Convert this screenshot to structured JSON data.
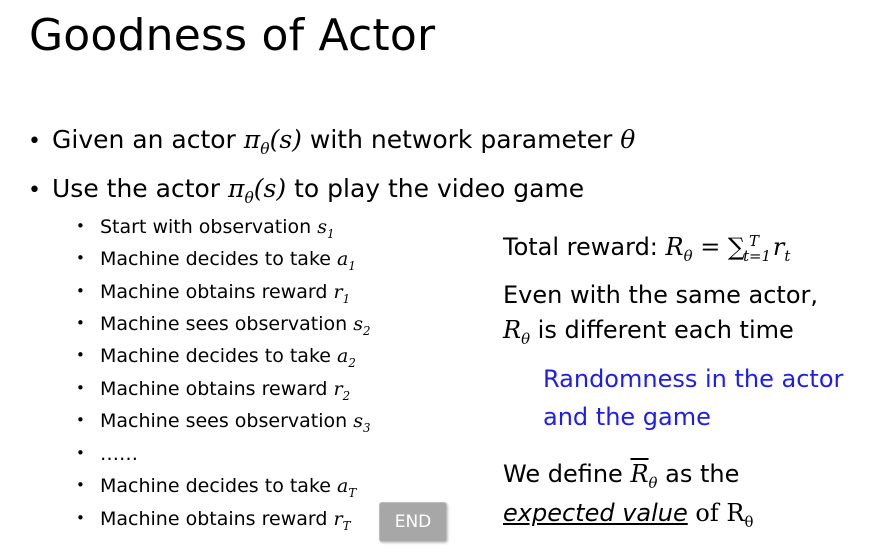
{
  "title": "Goodness of Actor",
  "bullets": [
    {
      "prefix": "Given an actor ",
      "pi": "π",
      "theta_sub": "θ",
      "arg": "(s)",
      "suffix": " with network parameter ",
      "theta": "θ"
    },
    {
      "prefix": "Use the actor ",
      "pi": "π",
      "theta_sub": "θ",
      "arg": "(s)",
      "suffix": " to play the video game"
    }
  ],
  "sub_bullets": [
    {
      "text": "Start with observation ",
      "var": "s",
      "sub": "1"
    },
    {
      "text": "Machine decides to take ",
      "var": "a",
      "sub": "1"
    },
    {
      "text": "Machine obtains reward ",
      "var": "r",
      "sub": "1"
    },
    {
      "text": "Machine sees observation ",
      "var": "s",
      "sub": "2"
    },
    {
      "text": "Machine decides to take ",
      "var": "a",
      "sub": "2"
    },
    {
      "text": "Machine obtains reward ",
      "var": "r",
      "sub": "2"
    },
    {
      "text": "Machine sees observation ",
      "var": "s",
      "sub": "3"
    },
    {
      "text": "……",
      "var": "",
      "sub": ""
    },
    {
      "text": "Machine decides to take ",
      "var": "a",
      "sub": "T"
    },
    {
      "text": "Machine obtains reward ",
      "var": "r",
      "sub": "T"
    }
  ],
  "end_button": "END",
  "right": {
    "total_reward_label": "Total reward: ",
    "R": "R",
    "theta": "θ",
    "equals_sum": " = ∑",
    "sum_sub": "t=1",
    "sum_sup": "T",
    "r": "r",
    "r_sub": "t",
    "even_line": "Even with the same actor,",
    "different_suffix": " is different each time",
    "blue_line1": "Randomness in the actor",
    "blue_line2": "and the game",
    "define_prefix": "We define ",
    "define_suffix": " as the",
    "expected_value": "expected value",
    "of": " of R"
  },
  "colors": {
    "accent_blue": "#1d1df0",
    "button_gray": "#a7a7a7"
  }
}
